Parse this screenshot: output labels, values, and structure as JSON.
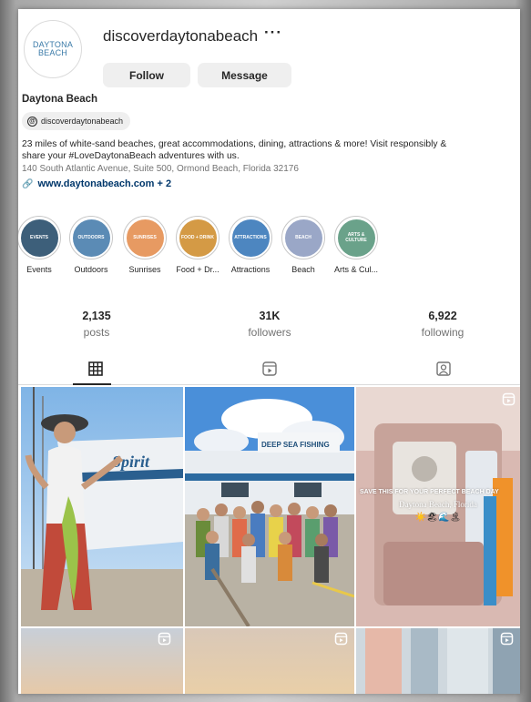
{
  "profile": {
    "avatar_line1": "DAYTONA",
    "avatar_line2": "BEACH",
    "username": "discoverdaytonabeach",
    "more": "···",
    "follow_label": "Follow",
    "message_label": "Message",
    "display_name": "Daytona Beach",
    "threads_handle": "discoverdaytonabeach",
    "bio_line1": "23 miles of white-sand beaches, great accommodations, dining, attractions & more! Visit responsibly &",
    "bio_line2": "share your #LoveDaytonaBeach adventures with us.",
    "address": "140 South Atlantic Avenue, Suite 500, Ormond Beach, Florida 32176",
    "website": "www.daytonabeach.com + 2"
  },
  "highlights": [
    {
      "label": "Events",
      "cover_text": "EVENTS",
      "color": "#3d5f7a"
    },
    {
      "label": "Outdoors",
      "cover_text": "OUTDOORS",
      "color": "#5b8bb5"
    },
    {
      "label": "Sunrises",
      "cover_text": "SUNRISES",
      "color": "#e79a62"
    },
    {
      "label": "Food + Dr...",
      "cover_text": "FOOD + DRINK",
      "color": "#d49a45"
    },
    {
      "label": "Attractions",
      "cover_text": "ATTRACTIONS",
      "color": "#4d86c0"
    },
    {
      "label": "Beach",
      "cover_text": "BEACH",
      "color": "#9aa7c7"
    },
    {
      "label": "Arts & Cul...",
      "cover_text": "ARTS & CULTURE",
      "color": "#6aa28a"
    }
  ],
  "stats": [
    {
      "value": "2,135",
      "label": "posts"
    },
    {
      "value": "31K",
      "label": "followers"
    },
    {
      "value": "6,922",
      "label": "following"
    }
  ],
  "tabs": [
    {
      "icon": "grid-icon",
      "active": true
    },
    {
      "icon": "reels-icon",
      "active": false
    },
    {
      "icon": "tagged-icon",
      "active": false
    }
  ],
  "posts": [
    {
      "caption": "",
      "boat_text": "Spirit"
    },
    {
      "boat_text": "DEEP SEA FISHING"
    },
    {
      "overlay_title": "SAVE THIS FOR YOUR PERFECT BEACH DAY",
      "overlay_sub": "Daytona Beach, Florida",
      "emojis": "☀️🏖🌊🏝"
    },
    {
      "type": "reel"
    },
    {
      "type": "reel"
    },
    {
      "type": "reel"
    }
  ]
}
